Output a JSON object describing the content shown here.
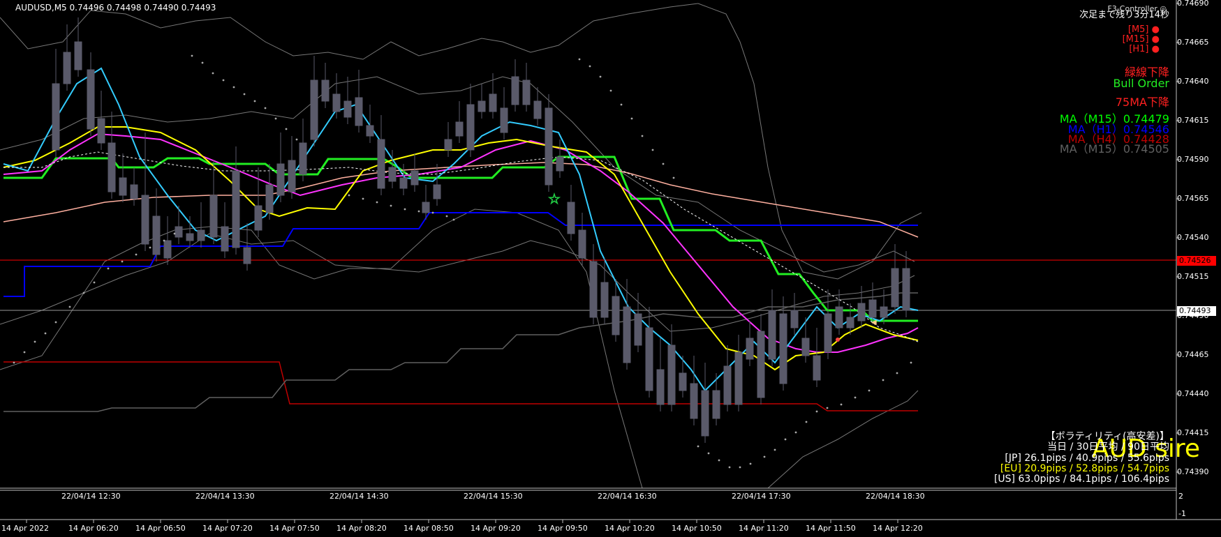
{
  "header": {
    "symbol_line": "AUDUSD,M5  0.74496 0.74498 0.74490 0.74493"
  },
  "panel": {
    "controller": "F3-Controller",
    "countdown": "次足まで残り3分14秒",
    "timeframes": [
      "[M5]",
      "[M15]",
      "[H1]"
    ],
    "signal_1": "緑線下降",
    "signal_2": "Bull Order",
    "signal_3": "75MA下降",
    "ma_lines": [
      {
        "text": "MA（M15）0.74479",
        "color": "#00ff00"
      },
      {
        "text": "MA（H1）0.74546",
        "color": "#0000ff"
      },
      {
        "text": "MA（H4）0.74428",
        "color": "#c00000"
      },
      {
        "text": "MA（M15）0.74505",
        "color": "#606060"
      }
    ]
  },
  "volatility": {
    "title": "【ボラティリティ(高安差)】",
    "symbol_big": "AUD sire",
    "lines": [
      {
        "text": "当日 / 30日平均 / 90日平均",
        "color": "#ffffff"
      },
      {
        "text": "[JP] 26.1pips / 40.9pips / 55.6pips",
        "color": "#ffffff"
      },
      {
        "text": "[EU] 20.9pips / 52.8pips / 54.7pips",
        "color": "#ffff00"
      },
      {
        "text": "[US] 63.0pips / 84.1pips / 106.4pips",
        "color": "#ffffff"
      }
    ]
  },
  "price_axis": [
    "0.74690",
    "0.74665",
    "0.74640",
    "0.74615",
    "0.74590",
    "0.74565",
    "0.74540",
    "0.74515",
    "0.74490",
    "0.74465",
    "0.74440",
    "0.74415",
    "0.74390"
  ],
  "price_tags": {
    "red_line": "0.74526",
    "bid": "0.74493"
  },
  "time_axis_top": [
    "22/04/14 12:30",
    "22/04/14 13:30",
    "22/04/14 14:30",
    "22/04/14 15:30",
    "22/04/14 16:30",
    "22/04/14 17:30",
    "22/04/14 18:30"
  ],
  "time_axis_bottom": [
    "14 Apr 2022",
    "14 Apr 06:20",
    "14 Apr 06:50",
    "14 Apr 07:20",
    "14 Apr 07:50",
    "14 Apr 08:20",
    "14 Apr 08:50",
    "14 Apr 09:20",
    "14 Apr 09:50",
    "14 Apr 10:20",
    "14 Apr 10:50",
    "14 Apr 11:20",
    "14 Apr 11:50",
    "14 Apr 12:20"
  ],
  "sub_axis": [
    "2",
    "-1"
  ],
  "colors": {
    "background": "#000000",
    "bull_candle": "#5a5a6a",
    "fast_ma": "#33ccff",
    "yellow_ma": "#ffff00",
    "magenta_ma": "#ff33ff",
    "salmon_ma": "#ffb0a0",
    "green_mtf": "#22ee22",
    "blue_mtf": "#0000ff",
    "red_mtf": "#c00000",
    "level_line": "#ff0000"
  }
}
